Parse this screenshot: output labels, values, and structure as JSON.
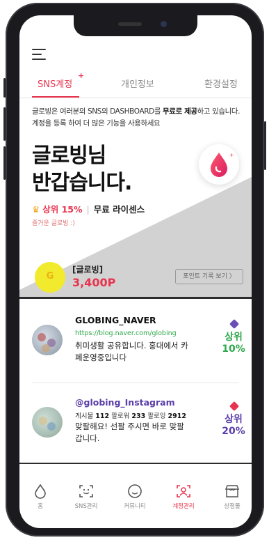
{
  "tabs": [
    {
      "label": "SNS계정",
      "active": true,
      "badge": "+"
    },
    {
      "label": "개인정보",
      "active": false
    },
    {
      "label": "환경설정",
      "active": false
    }
  ],
  "intro": {
    "line1_pre": "글로빙은 여러분의 SNS의 DASHBOARD를 ",
    "line1_bold": "무료로 제공",
    "line1_post": "하고 있습니다.",
    "line2": "계정을 등록 하여 더 많은 기능을 사용하세요"
  },
  "greeting": {
    "line1": "글로빙님",
    "line2": "반갑습니다."
  },
  "rank": {
    "label": "상위 15%",
    "separator": "|",
    "license": "무료 라이센스",
    "tagline": "즐거운 글로빙 :)"
  },
  "points": {
    "coin_letter": "G",
    "label": "[글로빙]",
    "value": "3,400P",
    "history_button": "포인트 기록 보기 〉"
  },
  "accounts": [
    {
      "name": "GLOBING_NAVER",
      "url": "https://blog.naver.com/globing",
      "desc": "취미생활 공유합니다. 홍대에서 카페운영중입니다",
      "rank_label": "상위",
      "rank_value": "10%",
      "rank_color": "#2ea84a",
      "gem_color": "#6a4fb5"
    },
    {
      "name": "@globing_Instagram",
      "stats": {
        "posts_label": "게시물",
        "posts": "112",
        "followers_label": "팔로워",
        "followers": "233",
        "following_label": "팔로잉",
        "following": "2912"
      },
      "desc": "맞팔해요! 선팔 주시면 바로 맞팔 갑니다.",
      "rank_label": "상위",
      "rank_value": "20%",
      "rank_color": "#5b3ea8",
      "gem_color": "#e8344e"
    }
  ],
  "nav": [
    {
      "label": "홈",
      "icon": "drop-icon",
      "active": false
    },
    {
      "label": "SNS관리",
      "icon": "face-scan-icon",
      "active": false
    },
    {
      "label": "커뮤니티",
      "icon": "smile-icon",
      "active": false
    },
    {
      "label": "계정관리",
      "icon": "account-scan-icon",
      "active": true
    },
    {
      "label": "상점몰",
      "icon": "shop-icon",
      "active": false
    }
  ],
  "colors": {
    "accent": "#e8344e",
    "green": "#2ea84a",
    "purple": "#5b3ea8"
  }
}
